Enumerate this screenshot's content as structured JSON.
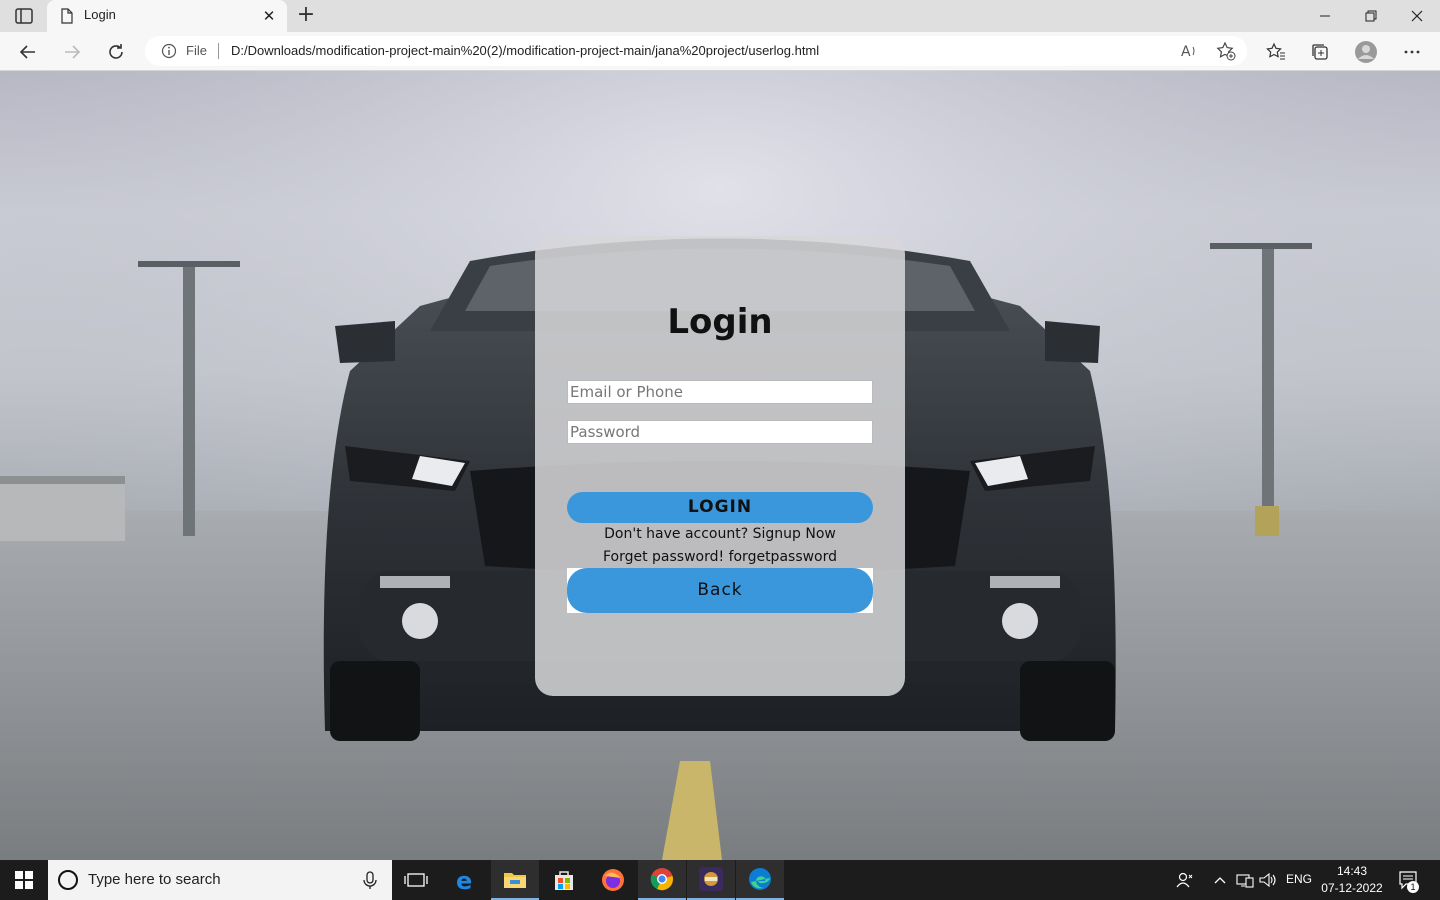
{
  "browser": {
    "tab_title": "Login",
    "address_scheme": "File",
    "url": "D:/Downloads/modification-project-main%20(2)/modification-project-main/jana%20project/userlog.html"
  },
  "login": {
    "title": "Login",
    "email_placeholder": "Email or Phone",
    "password_placeholder": "Password",
    "login_button": "LOGIN",
    "signup_prompt": "Don't have account?",
    "signup_link": "Signup Now",
    "forgot_prompt": "Forget password!",
    "forgot_link": "forgetpassword",
    "back_button": "Back"
  },
  "taskbar": {
    "search_placeholder": "Type here to search",
    "language": "ENG",
    "time": "14:43",
    "date": "07-12-2022",
    "notification_count": "1"
  },
  "colors": {
    "button_blue": "#3b97dc",
    "taskbar_bg": "#1c1c1c"
  }
}
